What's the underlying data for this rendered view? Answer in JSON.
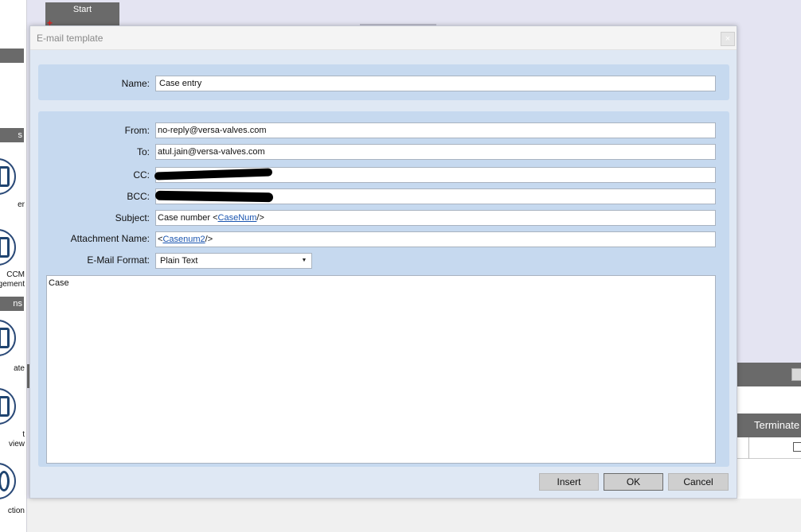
{
  "background": {
    "left_bar_labels": [
      "",
      "s",
      "ns"
    ],
    "left_labels": [
      "er",
      "CCM\nagement",
      "ate",
      "t\nview",
      "ction"
    ],
    "start_label": "Start",
    "start_mark": "+",
    "terminate_label": "Terminate"
  },
  "dialog": {
    "title": "E-mail template",
    "close_glyph": "×",
    "name": {
      "label": "Name:",
      "value": "Case entry"
    },
    "from": {
      "label": "From:",
      "value": "no-reply@versa-valves.com"
    },
    "to": {
      "label": "To:",
      "value": "atul.jain@versa-valves.com"
    },
    "cc": {
      "label": "CC:",
      "value": ""
    },
    "bcc": {
      "label": "BCC:",
      "value": ""
    },
    "subject": {
      "label": "Subject:",
      "prefix": "Case number <",
      "link": "CaseNum",
      "suffix": "/>"
    },
    "attachment": {
      "label": "Attachment Name:",
      "prefix": "<",
      "link": "Casenum2",
      "suffix": "/>"
    },
    "format": {
      "label": "E-Mail Format:",
      "value": "Plain Text",
      "arrow_glyph": "▼"
    },
    "body_text": "Case",
    "buttons": {
      "insert": "Insert",
      "ok": "OK",
      "cancel": "Cancel"
    }
  }
}
